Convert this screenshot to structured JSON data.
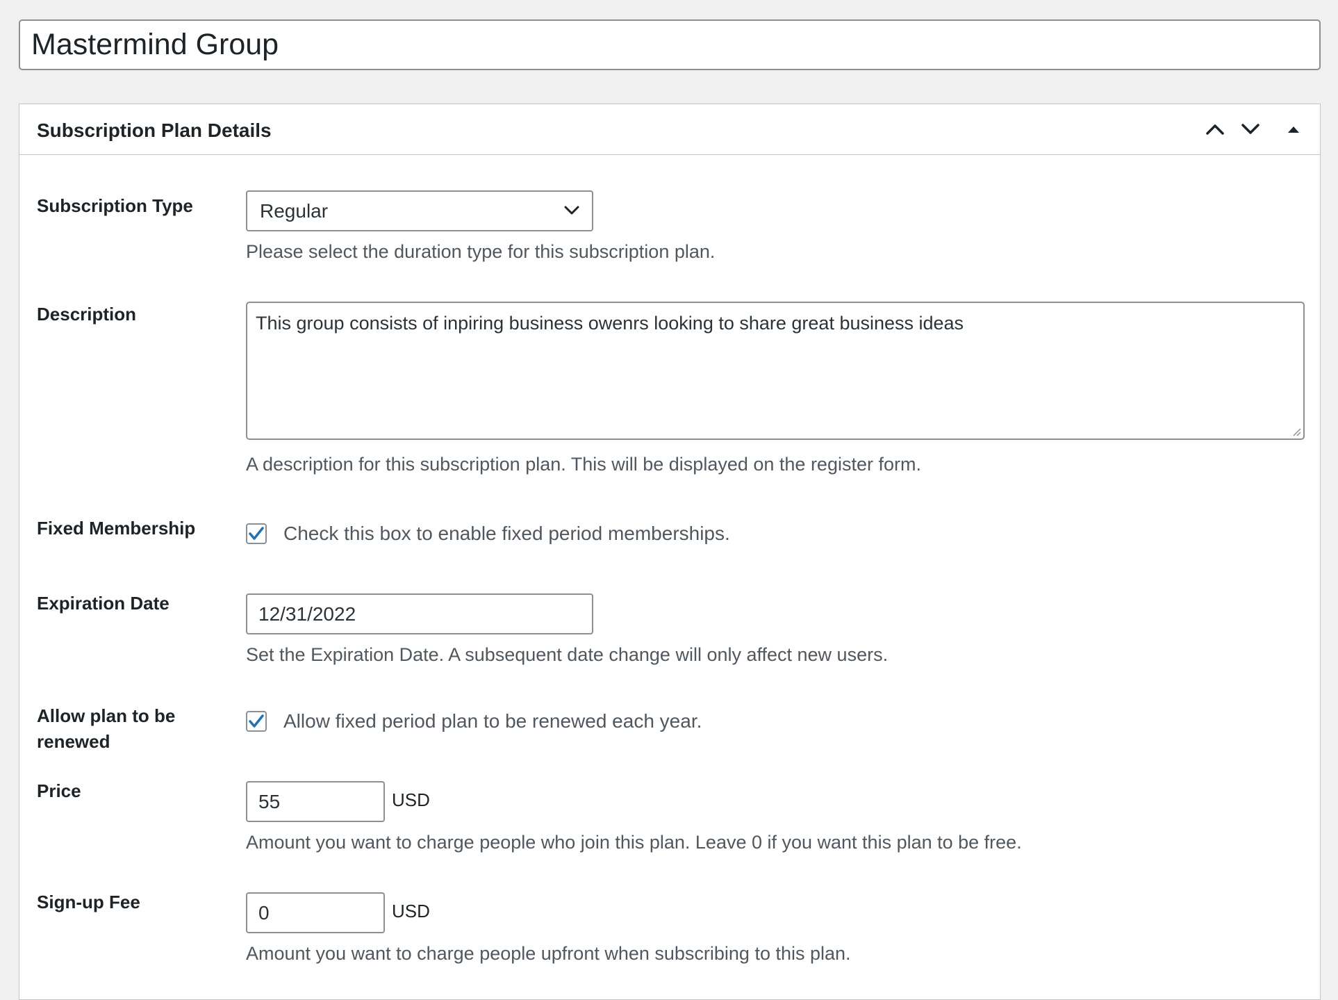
{
  "post": {
    "title": "Mastermind Group"
  },
  "metabox": {
    "title": "Subscription Plan Details",
    "controls": {
      "move_up_icon": "chevron-up-icon",
      "move_down_icon": "chevron-down-icon",
      "toggle_icon": "triangle-up-icon"
    }
  },
  "fields": {
    "subscription_type": {
      "label": "Subscription Type",
      "value": "Regular",
      "help": "Please select the duration type for this subscription plan."
    },
    "description": {
      "label": "Description",
      "value": "This group consists of inpiring business owenrs looking to share great business ideas",
      "help": "A description for this subscription plan. This will be displayed on the register form."
    },
    "fixed_membership": {
      "label": "Fixed Membership",
      "checked": true,
      "text": "Check this box to enable fixed period memberships."
    },
    "expiration_date": {
      "label": "Expiration Date",
      "value": "12/31/2022",
      "help": "Set the Expiration Date. A subsequent date change will only affect new users."
    },
    "allow_renew": {
      "label": "Allow plan to be renewed",
      "checked": true,
      "text": "Allow fixed period plan to be renewed each year."
    },
    "price": {
      "label": "Price",
      "value": "55",
      "unit": "USD",
      "help": "Amount you want to charge people who join this plan. Leave 0 if you want this plan to be free."
    },
    "signup_fee": {
      "label": "Sign-up Fee",
      "value": "0",
      "unit": "USD",
      "help": "Amount you want to charge people upfront when subscribing to this plan."
    }
  },
  "colors": {
    "accent": "#2271b1",
    "border": "#8c8f94",
    "help_text": "#50575e",
    "background": "#f0f0f1"
  }
}
